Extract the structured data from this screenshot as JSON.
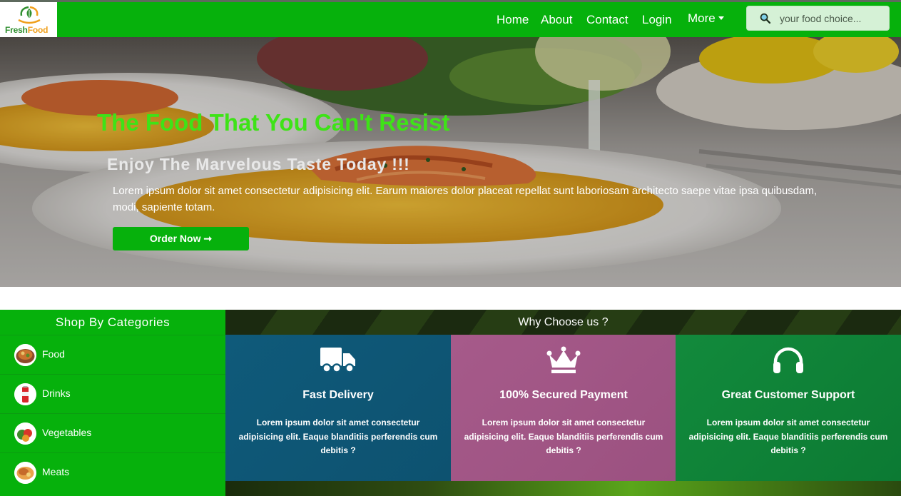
{
  "brand": {
    "logo_fresh": "Fresh",
    "logo_food": "Food",
    "primary_color": "#06b10c",
    "accent_color": "#f0a01c"
  },
  "nav": {
    "items": [
      {
        "label": "Home"
      },
      {
        "label": "About"
      },
      {
        "label": "Contact"
      },
      {
        "label": "Login"
      },
      {
        "label": "More"
      }
    ],
    "search_placeholder": "your food choice..."
  },
  "hero": {
    "title": "The Food That You Can't Resist",
    "subtitle": "Enjoy The Marvelous Taste Today !!!",
    "text": "Lorem ipsum dolor sit amet consectetur adipisicing elit. Earum maiores dolor placeat repellat sunt laboriosam architecto saepe vitae ipsa quibusdam, modi, sapiente totam.",
    "button_label": "Order Now ➞",
    "title_color": "#3ee317"
  },
  "categories": {
    "heading": "Shop By Categories",
    "items": [
      {
        "label": "Food",
        "icon": "food-icon"
      },
      {
        "label": "Drinks",
        "icon": "drinks-icon"
      },
      {
        "label": "Vegetables",
        "icon": "vegetables-icon"
      },
      {
        "label": "Meats",
        "icon": "meats-icon"
      }
    ]
  },
  "why": {
    "heading": "Why Choose us ?",
    "cards": [
      {
        "title": "Fast Delivery",
        "icon": "truck-icon",
        "text": "Lorem ipsum dolor sit amet consectetur adipisicing elit. Eaque blanditiis perferendis cum debitis ?"
      },
      {
        "title": "100% Secured Payment",
        "icon": "crown-icon",
        "text": "Lorem ipsum dolor sit amet consectetur adipisicing elit. Eaque blanditiis perferendis cum debitis ?"
      },
      {
        "title": "Great Customer Support",
        "icon": "headphones-icon",
        "text": "Lorem ipsum dolor sit amet consectetur adipisicing elit. Eaque blanditiis perferendis cum debitis ?"
      }
    ]
  }
}
